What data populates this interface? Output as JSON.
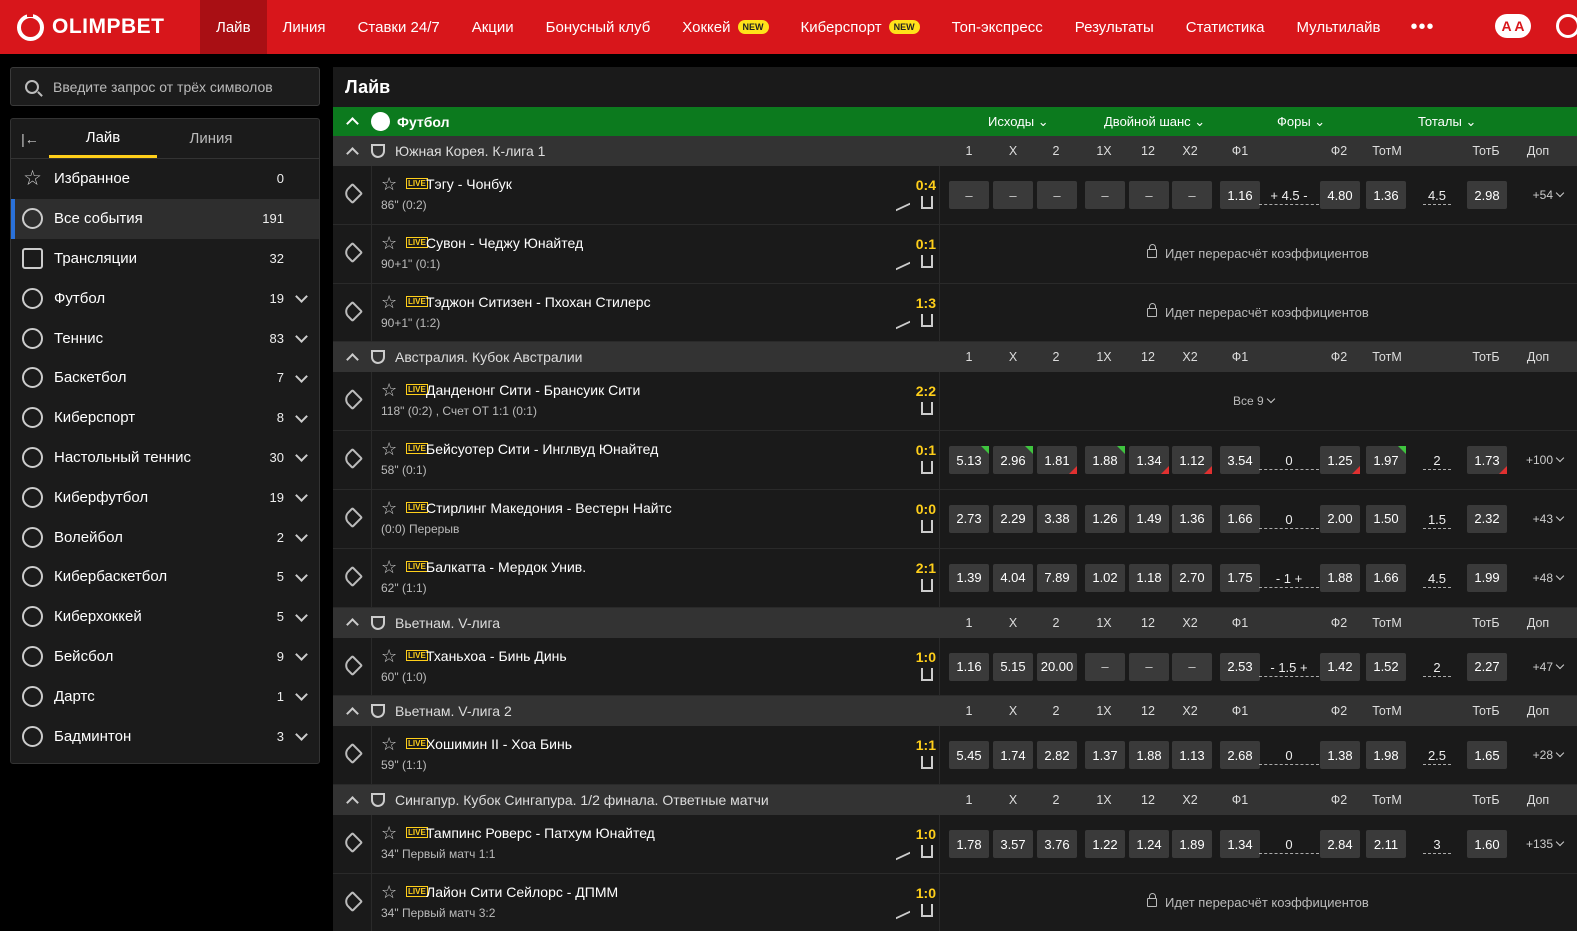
{
  "brand": "OLIMPBET",
  "nav": [
    {
      "label": "Лайв",
      "active": true,
      "badge": ""
    },
    {
      "label": "Линия",
      "badge": ""
    },
    {
      "label": "Ставки 24/7",
      "badge": ""
    },
    {
      "label": "Акции",
      "badge": ""
    },
    {
      "label": "Бонусный клуб",
      "badge": ""
    },
    {
      "label": "Хоккей",
      "badge": "NEW"
    },
    {
      "label": "Киберспорт",
      "badge": "NEW"
    },
    {
      "label": "Топ-экспресс",
      "badge": ""
    },
    {
      "label": "Результаты",
      "badge": ""
    },
    {
      "label": "Статистика",
      "badge": ""
    },
    {
      "label": "Мультилайв",
      "badge": ""
    }
  ],
  "nav_more": "•••",
  "font_toggle": "A A",
  "search": {
    "placeholder": "Введите запрос от трёх символов"
  },
  "sidebar": {
    "tabs": [
      "Лайв",
      "Линия"
    ],
    "items": [
      {
        "label": "Избранное",
        "count": "0",
        "icon": "star-icon",
        "chevron": false
      },
      {
        "label": "Все события",
        "count": "191",
        "icon": "globe-icon",
        "chevron": false,
        "active": true
      },
      {
        "label": "Трансляции",
        "count": "32",
        "icon": "play-icon",
        "chevron": false
      },
      {
        "label": "Футбол",
        "count": "19",
        "icon": "football-icon",
        "chevron": true
      },
      {
        "label": "Теннис",
        "count": "83",
        "icon": "tennis-icon",
        "chevron": true
      },
      {
        "label": "Баскетбол",
        "count": "7",
        "icon": "basketball-icon",
        "chevron": true
      },
      {
        "label": "Киберспорт",
        "count": "8",
        "icon": "gamepad-icon",
        "chevron": true
      },
      {
        "label": "Настольный теннис",
        "count": "30",
        "icon": "table-tennis-icon",
        "chevron": true
      },
      {
        "label": "Киберфутбол",
        "count": "19",
        "icon": "gamepad-icon",
        "chevron": true
      },
      {
        "label": "Волейбол",
        "count": "2",
        "icon": "volleyball-icon",
        "chevron": true
      },
      {
        "label": "Кибербаскетбол",
        "count": "5",
        "icon": "gamepad-icon",
        "chevron": true
      },
      {
        "label": "Киберхоккей",
        "count": "5",
        "icon": "gamepad-icon",
        "chevron": true
      },
      {
        "label": "Бейсбол",
        "count": "9",
        "icon": "baseball-icon",
        "chevron": true
      },
      {
        "label": "Дартс",
        "count": "1",
        "icon": "darts-icon",
        "chevron": true
      },
      {
        "label": "Бадминтон",
        "count": "3",
        "icon": "badminton-icon",
        "chevron": true
      }
    ]
  },
  "main": {
    "title": "Лайв",
    "sport": "Футбол",
    "groups": [
      "Исходы",
      "Двойной шанс",
      "Форы",
      "Тоталы"
    ],
    "columns": [
      "1",
      "X",
      "2",
      "1X",
      "12",
      "X2",
      "Ф1",
      "Ф2",
      "ТотМ",
      "ТотБ",
      "Доп"
    ],
    "lock_text": "Идет перерасчёт коэффициентов",
    "leagues": [
      {
        "name": "Южная Корея. К-лига 1",
        "events": [
          {
            "name": "Тэгу - Чонбук",
            "time": "86\" (0:2)",
            "score": "0:4",
            "trend": true,
            "state": "odds",
            "odds": [
              "–",
              "–",
              "–",
              "–",
              "–",
              "–",
              "1.16",
              "4.80",
              "1.36",
              "2.98"
            ],
            "hcp": "+ 4.5 -",
            "total": "4.5",
            "more": "+54",
            "flags": [
              "",
              "",
              "",
              "",
              "",
              "",
              "",
              "",
              "",
              ""
            ]
          },
          {
            "name": "Сувон - Чеджу Юнайтед",
            "time": "90+1\" (0:1)",
            "score": "0:1",
            "trend": true,
            "state": "locked"
          },
          {
            "name": "Тэджон Ситизен - Пхохан Стилерс",
            "time": "90+1\" (1:2)",
            "score": "1:3",
            "trend": true,
            "state": "locked"
          }
        ]
      },
      {
        "name": "Австралия. Кубок Австралии",
        "events": [
          {
            "name": "Данденонг Сити - Брансуик Сити",
            "time": "118\" (0:2) , Счет ОТ 1:1 (0:1)",
            "score": "2:2",
            "trend": false,
            "state": "all",
            "all_label": "Все 9"
          },
          {
            "name": "Бейсуотер Сити - Инглвуд Юнайтед",
            "time": "58\" (0:1)",
            "score": "0:1",
            "trend": false,
            "state": "odds",
            "odds": [
              "5.13",
              "2.96",
              "1.81",
              "1.88",
              "1.34",
              "1.12",
              "3.54",
              "1.25",
              "1.97",
              "1.73"
            ],
            "hcp": "0",
            "total": "2",
            "more": "+100",
            "flags": [
              "up",
              "up",
              "dn",
              "up",
              "dn",
              "dn",
              "",
              "dn",
              "up",
              "dn"
            ]
          },
          {
            "name": "Стирлинг Македония - Вестерн Найтс",
            "time": "(0:0) Перерыв",
            "score": "0:0",
            "trend": false,
            "state": "odds",
            "odds": [
              "2.73",
              "2.29",
              "3.38",
              "1.26",
              "1.49",
              "1.36",
              "1.66",
              "2.00",
              "1.50",
              "2.32"
            ],
            "hcp": "0",
            "total": "1.5",
            "more": "+43",
            "flags": [
              "",
              "",
              "",
              "",
              "",
              "",
              "",
              "",
              "",
              ""
            ]
          },
          {
            "name": "Балкатта - Мердок Унив.",
            "time": "62\" (1:1)",
            "score": "2:1",
            "trend": false,
            "state": "odds",
            "odds": [
              "1.39",
              "4.04",
              "7.89",
              "1.02",
              "1.18",
              "2.70",
              "1.75",
              "1.88",
              "1.66",
              "1.99"
            ],
            "hcp": "- 1 +",
            "total": "4.5",
            "more": "+48",
            "flags": [
              "",
              "",
              "",
              "",
              "",
              "",
              "",
              "",
              "",
              ""
            ]
          }
        ]
      },
      {
        "name": "Вьетнам. V-лига",
        "events": [
          {
            "name": "Тханьхоа - Бинь Динь",
            "time": "60\" (1:0)",
            "score": "1:0",
            "trend": false,
            "state": "odds",
            "odds": [
              "1.16",
              "5.15",
              "20.00",
              "–",
              "–",
              "–",
              "2.53",
              "1.42",
              "1.52",
              "2.27"
            ],
            "hcp": "- 1.5 +",
            "total": "2",
            "more": "+47",
            "flags": [
              "",
              "",
              "",
              "",
              "",
              "",
              "",
              "",
              "",
              ""
            ]
          }
        ]
      },
      {
        "name": "Вьетнам. V-лига 2",
        "events": [
          {
            "name": "Хошимин II - Хоа Бинь",
            "time": "59\" (1:1)",
            "score": "1:1",
            "trend": false,
            "state": "odds",
            "odds": [
              "5.45",
              "1.74",
              "2.82",
              "1.37",
              "1.88",
              "1.13",
              "2.68",
              "1.38",
              "1.98",
              "1.65"
            ],
            "hcp": "0",
            "total": "2.5",
            "more": "+28",
            "flags": [
              "",
              "",
              "",
              "",
              "",
              "",
              "",
              "",
              "",
              ""
            ]
          }
        ]
      },
      {
        "name": "Сингапур. Кубок Сингапура. 1/2 финала. Ответные матчи",
        "events": [
          {
            "name": "Тампинс Роверс - Патхум Юнайтед",
            "time": "34\" Первый матч 1:1",
            "score": "1:0",
            "trend": true,
            "state": "odds",
            "odds": [
              "1.78",
              "3.57",
              "3.76",
              "1.22",
              "1.24",
              "1.89",
              "1.34",
              "2.84",
              "2.11",
              "1.60"
            ],
            "hcp": "0",
            "total": "3",
            "more": "+135",
            "flags": [
              "",
              "",
              "",
              "",
              "",
              "",
              "",
              "",
              "",
              ""
            ]
          },
          {
            "name": "Лайон Сити Сейлорс - ДПММ",
            "time": "34\" Первый матч 3:2",
            "score": "1:0",
            "trend": true,
            "state": "locked"
          }
        ]
      }
    ]
  },
  "colors": {
    "brand_red": "#d8161b",
    "sport_green": "#0c7a1e",
    "score_yellow": "#ffcf1a",
    "odd_up": "#3fc43f",
    "odd_down": "#e03030"
  }
}
